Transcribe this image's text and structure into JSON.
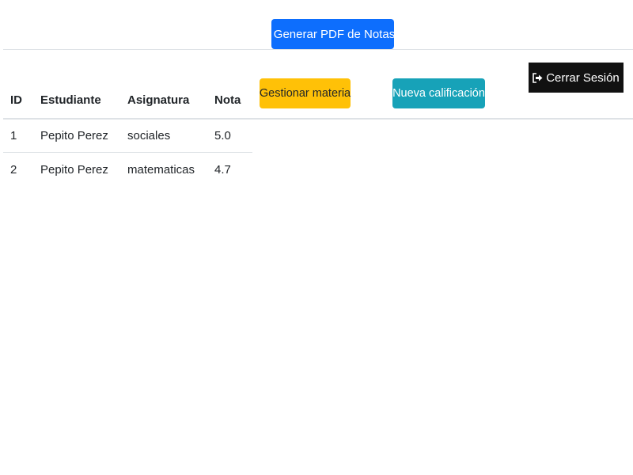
{
  "toolbar": {
    "pdf_button_label": "Generar PDF de Notas",
    "logout_button_label": "Cerrar Sesión",
    "manage_subject_label": "Gestionar materia",
    "new_grade_label": "Nueva calificación"
  },
  "icons": {
    "pdf": "file-pdf-icon",
    "logout": "sign-out-icon"
  },
  "colors": {
    "primary": "#0d6efd",
    "warning": "#ffc107",
    "info": "#17a2b8",
    "dark": "#111111"
  },
  "table": {
    "headers": [
      "ID",
      "Estudiante",
      "Asignatura",
      "Nota"
    ],
    "rows": [
      [
        "1",
        "Pepito Perez",
        "sociales",
        "5.0"
      ],
      [
        "2",
        "Pepito Perez",
        "matematicas",
        "4.7"
      ]
    ]
  }
}
